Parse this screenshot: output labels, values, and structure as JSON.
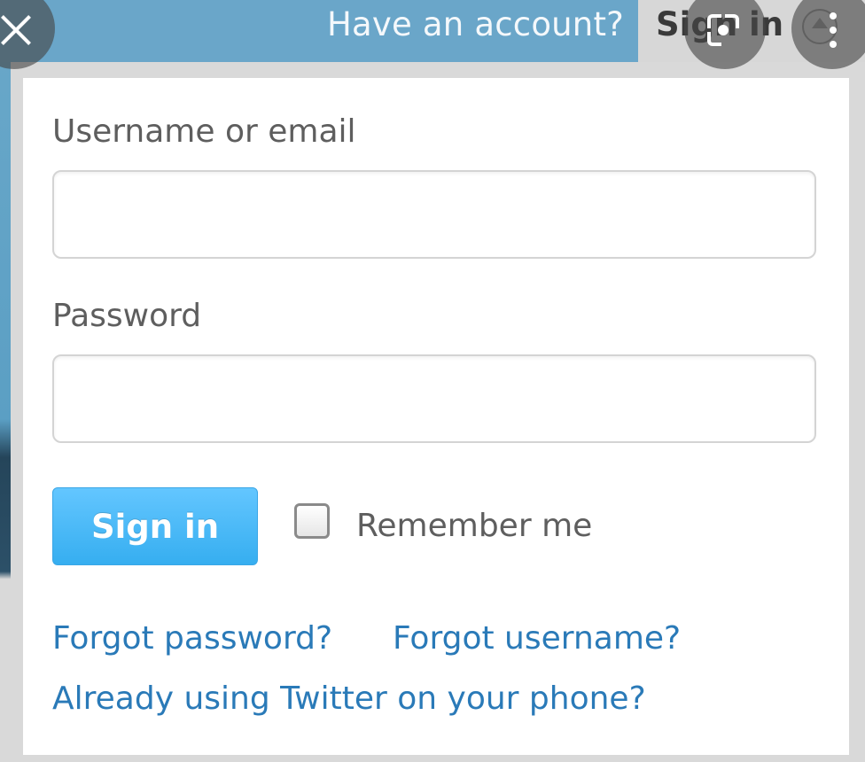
{
  "header": {
    "prompt": "Have an account?",
    "tab_label": "Sign in"
  },
  "form": {
    "username_label": "Username or email",
    "username_value": "",
    "password_label": "Password",
    "password_value": "",
    "signin_button": "Sign in",
    "remember_label": "Remember me",
    "remember_checked": false
  },
  "links": {
    "forgot_password": "Forgot password?",
    "forgot_username": "Forgot username?",
    "twitter_phone": "Already using Twitter on your phone?"
  },
  "overlay": {
    "close_icon": "close-icon",
    "lens_icon": "lens-icon",
    "more_icon": "more-vert-icon"
  },
  "colors": {
    "header_bar": "#6aa6c9",
    "button": "#36aef0",
    "link": "#2a7ab8"
  }
}
